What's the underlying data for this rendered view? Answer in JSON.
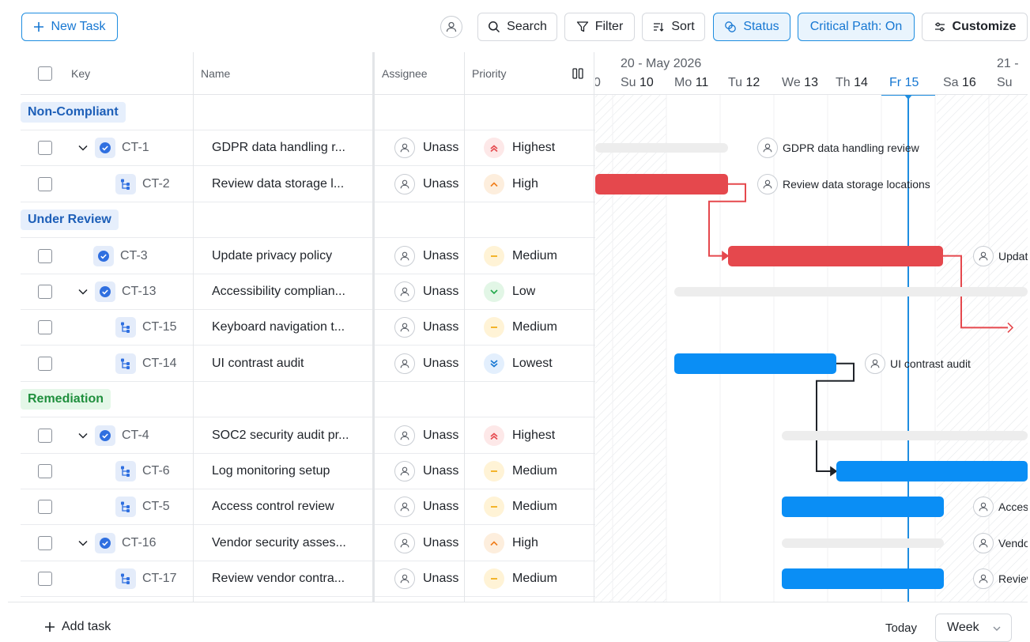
{
  "toolbar": {
    "new_task": "New Task",
    "search": "Search",
    "filter": "Filter",
    "sort": "Sort",
    "status": "Status",
    "critical_path": "Critical Path: On",
    "customize": "Customize"
  },
  "columns": {
    "key": "Key",
    "name": "Name",
    "assignee": "Assignee",
    "priority": "Priority"
  },
  "groups": [
    {
      "label": "Non-Compliant",
      "color": "#1d5fb8",
      "bg": "#e6effc"
    },
    {
      "label": "Under Review",
      "color": "#1d5fb8",
      "bg": "#e6effc"
    },
    {
      "label": "Remediation",
      "color": "#1f8f3d",
      "bg": "#e4f7e8"
    }
  ],
  "rows": [
    {
      "key": "CT-1",
      "name": "GDPR data handling r...",
      "assignee": "Unass",
      "priority": "Highest"
    },
    {
      "key": "CT-2",
      "name": "Review data storage l...",
      "assignee": "Unass",
      "priority": "High"
    },
    {
      "key": "CT-3",
      "name": "Update privacy policy",
      "assignee": "Unass",
      "priority": "Medium"
    },
    {
      "key": "CT-13",
      "name": "Accessibility complian...",
      "assignee": "Unass",
      "priority": "Low"
    },
    {
      "key": "CT-15",
      "name": "Keyboard navigation t...",
      "assignee": "Unass",
      "priority": "Medium"
    },
    {
      "key": "CT-14",
      "name": "UI contrast audit",
      "assignee": "Unass",
      "priority": "Lowest"
    },
    {
      "key": "CT-4",
      "name": "SOC2 security audit pr...",
      "assignee": "Unass",
      "priority": "Highest"
    },
    {
      "key": "CT-6",
      "name": "Log monitoring setup",
      "assignee": "Unass",
      "priority": "Medium"
    },
    {
      "key": "CT-5",
      "name": "Access control review",
      "assignee": "Unass",
      "priority": "Medium"
    },
    {
      "key": "CT-16",
      "name": "Vendor security asses...",
      "assignee": "Unass",
      "priority": "High"
    },
    {
      "key": "CT-17",
      "name": "Review vendor contra...",
      "assignee": "Unass",
      "priority": "Medium"
    }
  ],
  "timeline": {
    "week_label": "20 - May 2026",
    "next_week_label": "21 -",
    "days": [
      {
        "dow": "Su",
        "num": "10"
      },
      {
        "dow": "Mo",
        "num": "11"
      },
      {
        "dow": "Tu",
        "num": "12"
      },
      {
        "dow": "We",
        "num": "13"
      },
      {
        "dow": "Th",
        "num": "14"
      },
      {
        "dow": "Fr",
        "num": "15"
      },
      {
        "dow": "Sa",
        "num": "16"
      },
      {
        "dow": "Su",
        "num": ""
      }
    ],
    "bar_labels": {
      "ct1": "GDPR data handling review",
      "ct2": "Review data storage locations",
      "ct3": "Updat",
      "ct14": "UI contrast audit",
      "ct5": "Access",
      "ct16": "Vendo",
      "ct17": "Review"
    },
    "colors": {
      "critical": "#e5484d",
      "normal": "#0a8ef5",
      "today": "#1e8de0",
      "track": "#ededed"
    }
  },
  "footer": {
    "add_task": "Add task",
    "today": "Today",
    "zoom": "Week"
  },
  "icons": [
    "plus-icon",
    "user-icon",
    "search-icon",
    "filter-icon",
    "sort-icon",
    "status-icon",
    "sliders-icon",
    "columns-icon",
    "chevron-down-icon",
    "check-circle-icon",
    "subtask-icon",
    "priority-icon"
  ]
}
